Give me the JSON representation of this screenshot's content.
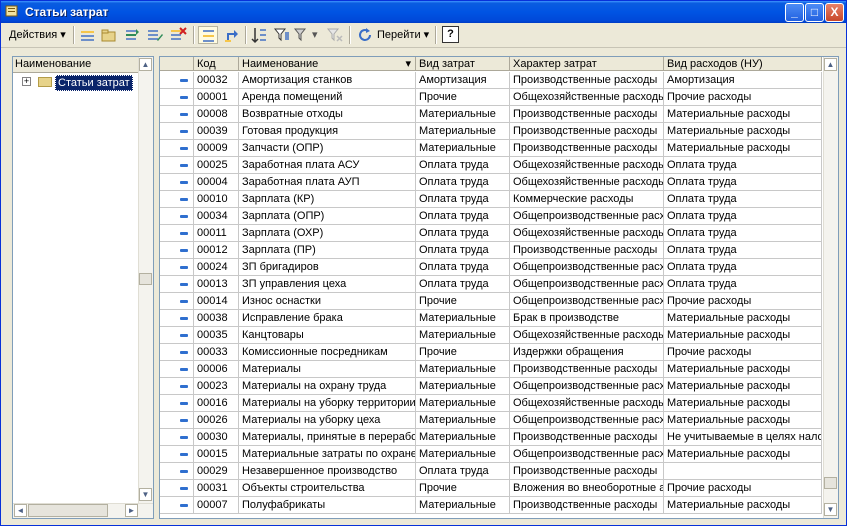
{
  "window": {
    "title": "Статьи затрат",
    "controls": {
      "minimize": "_",
      "maximize": "□",
      "close": "X"
    }
  },
  "toolbar": {
    "actions_label": "Действия",
    "goto_label": "Перейти",
    "help_label": "?",
    "dropdown_glyph": "▾"
  },
  "tree": {
    "header": "Наименование",
    "root_label": "Статьи затрат",
    "expander": "+"
  },
  "grid": {
    "columns": [
      "Код",
      "Наименование",
      "Вид затрат",
      "Характер затрат",
      "Вид расходов (НУ)"
    ],
    "sort_indicator": "▾",
    "rows": [
      [
        "00032",
        "Амортизация станков",
        "Амортизация",
        "Производственные расходы",
        "Амортизация"
      ],
      [
        "00001",
        "Аренда помещений",
        "Прочие",
        "Общехозяйственные расходы",
        "Прочие расходы"
      ],
      [
        "00008",
        "Возвратные отходы",
        "Материальные",
        "Производственные расходы",
        "Материальные расходы"
      ],
      [
        "00039",
        "Готовая продукция",
        "Материальные",
        "Производственные расходы",
        "Материальные расходы"
      ],
      [
        "00009",
        "Запчасти (ОПР)",
        "Материальные",
        "Производственные расходы",
        "Материальные расходы"
      ],
      [
        "00025",
        "Заработная плата АСУ",
        "Оплата труда",
        "Общехозяйственные расходы",
        "Оплата труда"
      ],
      [
        "00004",
        "Заработная плата АУП",
        "Оплата труда",
        "Общехозяйственные расходы",
        "Оплата труда"
      ],
      [
        "00010",
        "Зарплата (КР)",
        "Оплата труда",
        "Коммерческие расходы",
        "Оплата труда"
      ],
      [
        "00034",
        "Зарплата (ОПР)",
        "Оплата труда",
        "Общепроизводственные расходы",
        "Оплата труда"
      ],
      [
        "00011",
        "Зарплата (ОХР)",
        "Оплата труда",
        "Общехозяйственные расходы",
        "Оплата труда"
      ],
      [
        "00012",
        "Зарплата (ПР)",
        "Оплата труда",
        "Производственные расходы",
        "Оплата труда"
      ],
      [
        "00024",
        "ЗП бригадиров",
        "Оплата труда",
        "Общепроизводственные расходы",
        "Оплата труда"
      ],
      [
        "00013",
        "ЗП управления цеха",
        "Оплата труда",
        "Общепроизводственные расходы",
        "Оплата труда"
      ],
      [
        "00014",
        "Износ оснастки",
        "Прочие",
        "Общепроизводственные расходы",
        "Прочие расходы"
      ],
      [
        "00038",
        "Исправление брака",
        "Материальные",
        "Брак в производстве",
        "Материальные расходы"
      ],
      [
        "00035",
        "Канцтовары",
        "Материальные",
        "Общехозяйственные расходы",
        "Материальные расходы"
      ],
      [
        "00033",
        "Комиссионные посредникам",
        "Прочие",
        "Издержки обращения",
        "Прочие расходы"
      ],
      [
        "00006",
        "Материалы",
        "Материальные",
        "Производственные расходы",
        "Материальные расходы"
      ],
      [
        "00023",
        "Материалы на охрану труда",
        "Материальные",
        "Общепроизводственные расходы",
        "Материальные расходы"
      ],
      [
        "00016",
        "Материалы на уборку территории",
        "Материальные",
        "Общехозяйственные расходы",
        "Материальные расходы"
      ],
      [
        "00026",
        "Материалы на уборку цеха",
        "Материальные",
        "Общепроизводственные расходы",
        "Материальные расходы"
      ],
      [
        "00030",
        "Материалы,  принятые в переработку",
        "Материальные",
        "Производственные расходы",
        "Не учитываемые в целях налогообложения"
      ],
      [
        "00015",
        "Материальные затраты по охране труда",
        "Материальные",
        "Общепроизводственные расходы",
        "Материальные расходы"
      ],
      [
        "00029",
        "Незавершенное производство",
        "Оплата труда",
        "Производственные расходы",
        ""
      ],
      [
        "00031",
        "Объекты строительства",
        "Прочие",
        "Вложения во внеоборотные активы",
        "Прочие расходы"
      ],
      [
        "00007",
        "Полуфабрикаты",
        "Материальные",
        "Производственные расходы",
        "Материальные расходы"
      ]
    ]
  },
  "scroll": {
    "up": "▲",
    "down": "▼",
    "left": "◄",
    "right": "►"
  }
}
